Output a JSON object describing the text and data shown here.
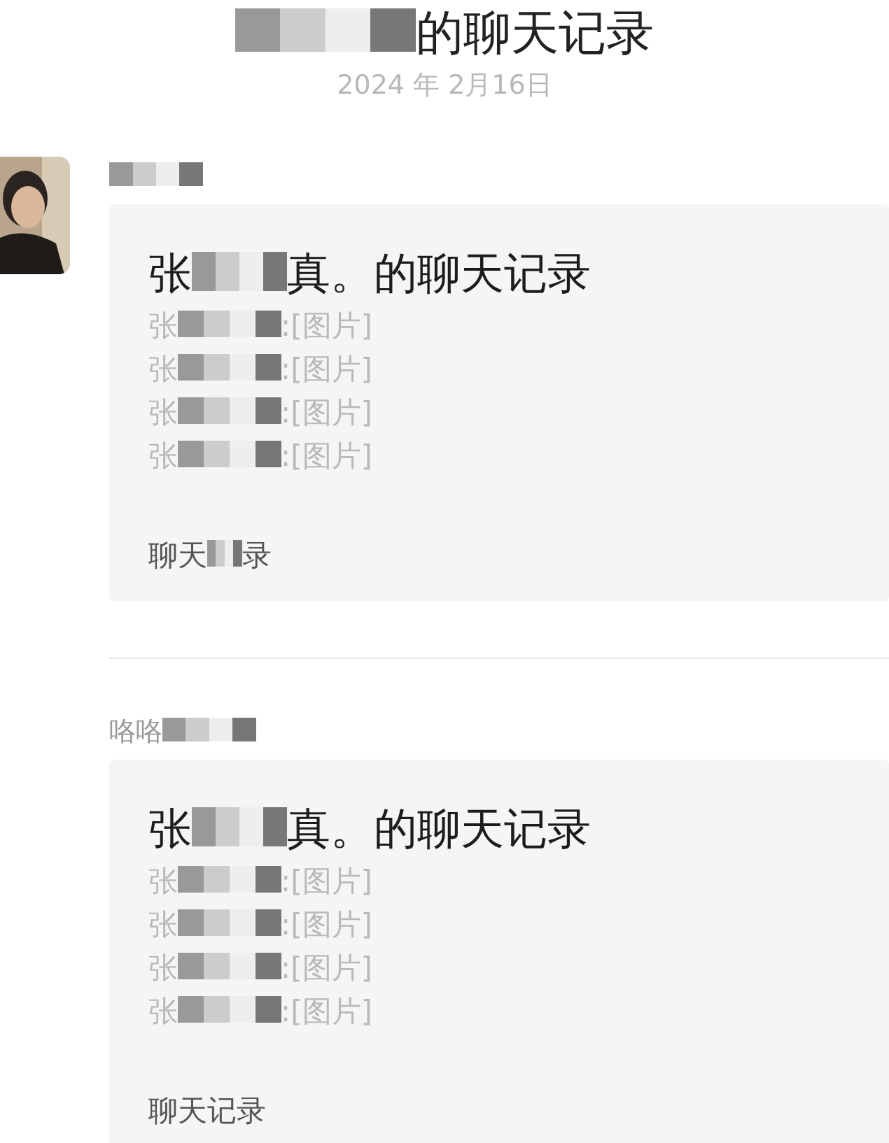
{
  "header": {
    "title": [
      {
        "kind": "redacted"
      },
      {
        "kind": "text",
        "text": "的聊天记录"
      }
    ],
    "date": "2024 年 2月16日"
  },
  "messages": [
    {
      "avatar": true,
      "sender": [
        {
          "kind": "redacted"
        }
      ],
      "card": {
        "title": [
          {
            "kind": "text",
            "text": "张"
          },
          {
            "kind": "redacted"
          },
          {
            "kind": "text",
            "text": "真。的聊天记录"
          }
        ],
        "lines": [
          [
            {
              "kind": "text",
              "text": "张"
            },
            {
              "kind": "redacted"
            },
            {
              "kind": "text",
              "text": ":[图片]"
            }
          ],
          [
            {
              "kind": "text",
              "text": "张"
            },
            {
              "kind": "redacted"
            },
            {
              "kind": "text",
              "text": ":[图片]"
            }
          ],
          [
            {
              "kind": "text",
              "text": "张"
            },
            {
              "kind": "redacted"
            },
            {
              "kind": "text",
              "text": ":[图片]"
            }
          ],
          [
            {
              "kind": "text",
              "text": "张"
            },
            {
              "kind": "redacted"
            },
            {
              "kind": "text",
              "text": ":[图片]"
            }
          ]
        ],
        "footer": [
          {
            "kind": "text",
            "text": "聊天"
          },
          {
            "kind": "redacted"
          },
          {
            "kind": "text",
            "text": "录"
          }
        ]
      }
    },
    {
      "avatar": false,
      "sender": [
        {
          "kind": "text",
          "text": "咯咯"
        },
        {
          "kind": "redacted"
        }
      ],
      "card": {
        "title": [
          {
            "kind": "text",
            "text": "张"
          },
          {
            "kind": "redacted"
          },
          {
            "kind": "text",
            "text": "真。的聊天记录"
          }
        ],
        "lines": [
          [
            {
              "kind": "text",
              "text": "张"
            },
            {
              "kind": "redacted"
            },
            {
              "kind": "text",
              "text": ":[图片]"
            }
          ],
          [
            {
              "kind": "text",
              "text": "张"
            },
            {
              "kind": "redacted"
            },
            {
              "kind": "text",
              "text": ":[图片]"
            }
          ],
          [
            {
              "kind": "text",
              "text": "张"
            },
            {
              "kind": "redacted"
            },
            {
              "kind": "text",
              "text": ":[图片]"
            }
          ],
          [
            {
              "kind": "text",
              "text": "张"
            },
            {
              "kind": "redacted"
            },
            {
              "kind": "text",
              "text": ":[图片]"
            }
          ]
        ],
        "footer": [
          {
            "kind": "text",
            "text": "聊天记录"
          }
        ]
      }
    }
  ]
}
